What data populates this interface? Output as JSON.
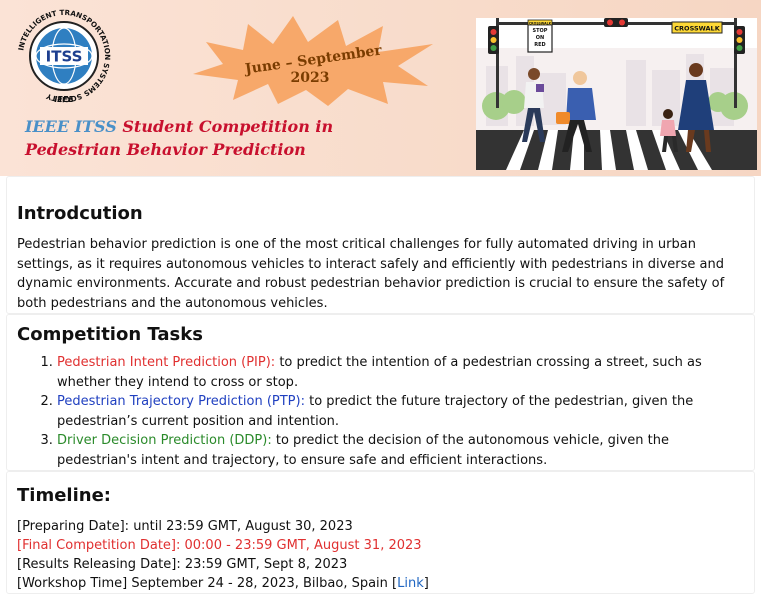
{
  "banner": {
    "logo_text": "ITSS",
    "logo_ring_text": "INTELLIGENT TRANSPORTATION SYSTEMS SOCIETY",
    "logo_bottom_text": "IEEE",
    "date_range": "June – September",
    "date_year": "2023",
    "title_prefix": "IEEE ITSS",
    "title_rest": " Student Competition in",
    "title_line2": "Pedestrian Behavior Prediction",
    "sign_stop": [
      "STOP",
      "ON",
      "RED"
    ],
    "sign_crosswalk_small": "CROSSWALK",
    "sign_crosswalk_big": "CROSSWALK"
  },
  "intro": {
    "heading": "Introdcution",
    "paragraph": "Pedestrian behavior prediction is one of the most critical challenges for fully automated driving in urban settings, as it requires autonomous vehicles to interact safely and efficiently with pedestrians in diverse and dynamic environments. Accurate and robust pedestrian behavior prediction is crucial to ensure the safety of both pedestrians and the autonomous vehicles."
  },
  "tasks": {
    "heading": "Competition Tasks",
    "items": [
      {
        "name": "Pedestrian Intent Prediction (PIP):",
        "desc": " to predict the intention of a pedestrian crossing a street, such as whether they intend to cross or stop.",
        "color": "#e03030"
      },
      {
        "name": "Pedestrian Trajectory Prediction (PTP):",
        "desc": " to predict the future trajectory of the pedestrian, given the pedestrian’s current position and intention.",
        "color": "#2040c0"
      },
      {
        "name": "Driver Decision Prediction (DDP):",
        "desc": " to predict the decision of the autonomous vehicle, given the pedestrian's intent and trajectory, to ensure safe and efficient interactions.",
        "color": "#2a8a2a"
      }
    ]
  },
  "timeline": {
    "heading": "Timeline:",
    "preparing": "[Preparing Date]: until 23:59 GMT, August 30, 2023",
    "final": "[Final Competition Date]: 00:00 - 23:59 GMT, August 31, 2023",
    "results": "[Results Releasing Date]: 23:59 GMT, Sept 8, 2023",
    "workshop_prefix": "[Workshop Time] September 24 - 28, 2023, Bilbao, Spain [",
    "workshop_link": "Link",
    "workshop_suffix": "]"
  },
  "colors": {
    "accent_red": "#e03030",
    "accent_blue": "#2040c0",
    "accent_green": "#2a8a2a",
    "link": "#1f66c2",
    "banner_bg": "#fbe3d6",
    "burst": "#f7a86a"
  }
}
